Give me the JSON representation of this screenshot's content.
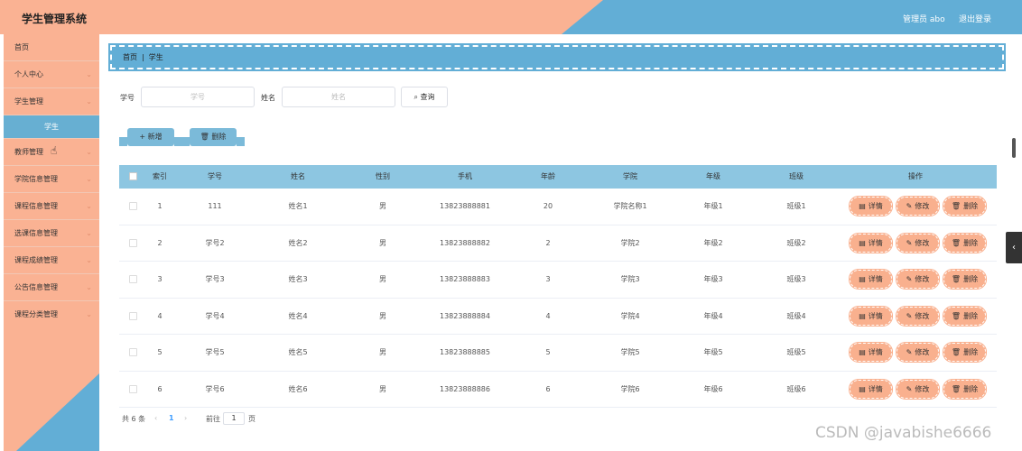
{
  "header": {
    "title": "学生管理系统",
    "user": "管理员 abo",
    "logout": "退出登录",
    "colors": {
      "salmon": "#fab293",
      "blue": "#62aed6"
    }
  },
  "sidebar": {
    "items": [
      {
        "label": "首页",
        "chevron": ""
      },
      {
        "label": "个人中心",
        "chevron": "⌄"
      },
      {
        "label": "学生管理",
        "chevron": "⌄"
      },
      {
        "label": "学生",
        "chevron": ""
      },
      {
        "label": "教师管理",
        "chevron": "⌄"
      },
      {
        "label": "学院信息管理",
        "chevron": "⌄"
      },
      {
        "label": "课程信息管理",
        "chevron": "⌄"
      },
      {
        "label": "选课信息管理",
        "chevron": "⌄"
      },
      {
        "label": "课程成绩管理",
        "chevron": "⌄"
      },
      {
        "label": "公告信息管理",
        "chevron": "⌄"
      },
      {
        "label": "课程分类管理",
        "chevron": "⌄"
      }
    ]
  },
  "breadcrumb": {
    "home": "首页",
    "sep": "|",
    "current": "学生"
  },
  "search": {
    "id_label": "学号",
    "id_placeholder": "学号",
    "name_label": "姓名",
    "name_placeholder": "姓名",
    "query": "查询",
    "query_icon": "⌕"
  },
  "actions": {
    "add": "新增",
    "add_icon": "+",
    "delete": "删除",
    "delete_icon": "🗑"
  },
  "table": {
    "headers": [
      "索引",
      "学号",
      "姓名",
      "性别",
      "手机",
      "年龄",
      "学院",
      "年级",
      "班级",
      "操作"
    ],
    "ops": {
      "detail": "详情",
      "detail_icon": "▤",
      "edit": "修改",
      "edit_icon": "✎",
      "delete": "删除",
      "delete_icon": "🗑"
    },
    "rows": [
      {
        "index": "1",
        "sid": "111",
        "name": "姓名1",
        "gender": "男",
        "phone": "13823888881",
        "age": "20",
        "college": "学院名称1",
        "grade": "年级1",
        "cls": "班级1"
      },
      {
        "index": "2",
        "sid": "学号2",
        "name": "姓名2",
        "gender": "男",
        "phone": "13823888882",
        "age": "2",
        "college": "学院2",
        "grade": "年级2",
        "cls": "班级2"
      },
      {
        "index": "3",
        "sid": "学号3",
        "name": "姓名3",
        "gender": "男",
        "phone": "13823888883",
        "age": "3",
        "college": "学院3",
        "grade": "年级3",
        "cls": "班级3"
      },
      {
        "index": "4",
        "sid": "学号4",
        "name": "姓名4",
        "gender": "男",
        "phone": "13823888884",
        "age": "4",
        "college": "学院4",
        "grade": "年级4",
        "cls": "班级4"
      },
      {
        "index": "5",
        "sid": "学号5",
        "name": "姓名5",
        "gender": "男",
        "phone": "13823888885",
        "age": "5",
        "college": "学院5",
        "grade": "年级5",
        "cls": "班级5"
      },
      {
        "index": "6",
        "sid": "学号6",
        "name": "姓名6",
        "gender": "男",
        "phone": "13823888886",
        "age": "6",
        "college": "学院6",
        "grade": "年级6",
        "cls": "班级6"
      }
    ]
  },
  "pager": {
    "total": "共 6 条",
    "prev": "‹",
    "current": "1",
    "next": "›",
    "goto": "前往",
    "page_value": "1",
    "page_unit": "页"
  },
  "misc": {
    "toggle": "‹",
    "watermark": "CSDN @javabishe6666",
    "cursor": "☝"
  }
}
